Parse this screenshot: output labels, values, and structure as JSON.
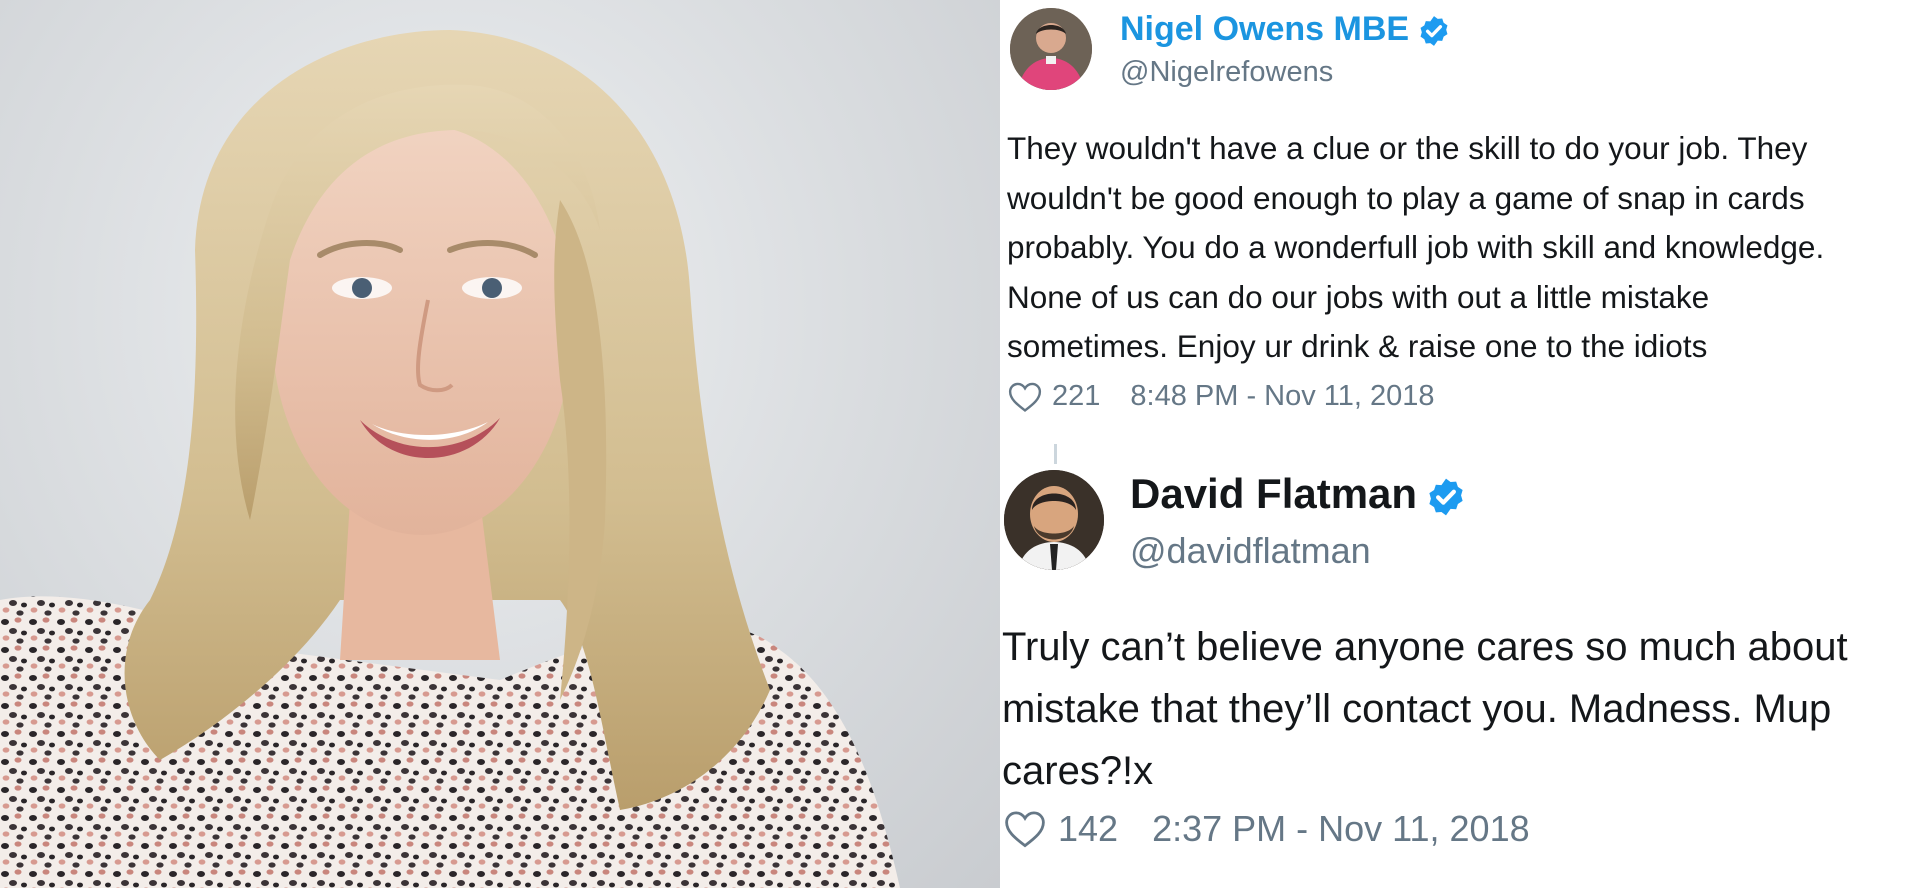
{
  "tweets": [
    {
      "name": "Nigel Owens MBE",
      "handle": "@Nigelrefowens",
      "verified_color": "#1d9bf0",
      "name_color": "#1b95e0",
      "body_lines": [
        "They wouldn't have a clue or the skill to do your job. They",
        "wouldn't be good enough to play a game of snap in cards",
        "probably. You do a wonderfull job with skill and knowledge.",
        "None of us can do our jobs with out a little mistake",
        "sometimes. Enjoy ur drink & raise one to the idiots"
      ],
      "likes": "221",
      "timestamp": "8:48 PM - Nov 11, 2018",
      "like_icon": "heart-outline-icon"
    },
    {
      "name": "David Flatman",
      "handle": "@davidflatman",
      "verified_color": "#1d9bf0",
      "name_color": "#14171a",
      "body_lines": [
        "Truly can’t believe anyone cares so much about",
        "mistake that they’ll contact you. Madness. Mup",
        "cares?!x"
      ],
      "likes": "142",
      "timestamp": "2:37 PM - Nov 11, 2018",
      "like_icon": "heart-outline-icon"
    }
  ]
}
